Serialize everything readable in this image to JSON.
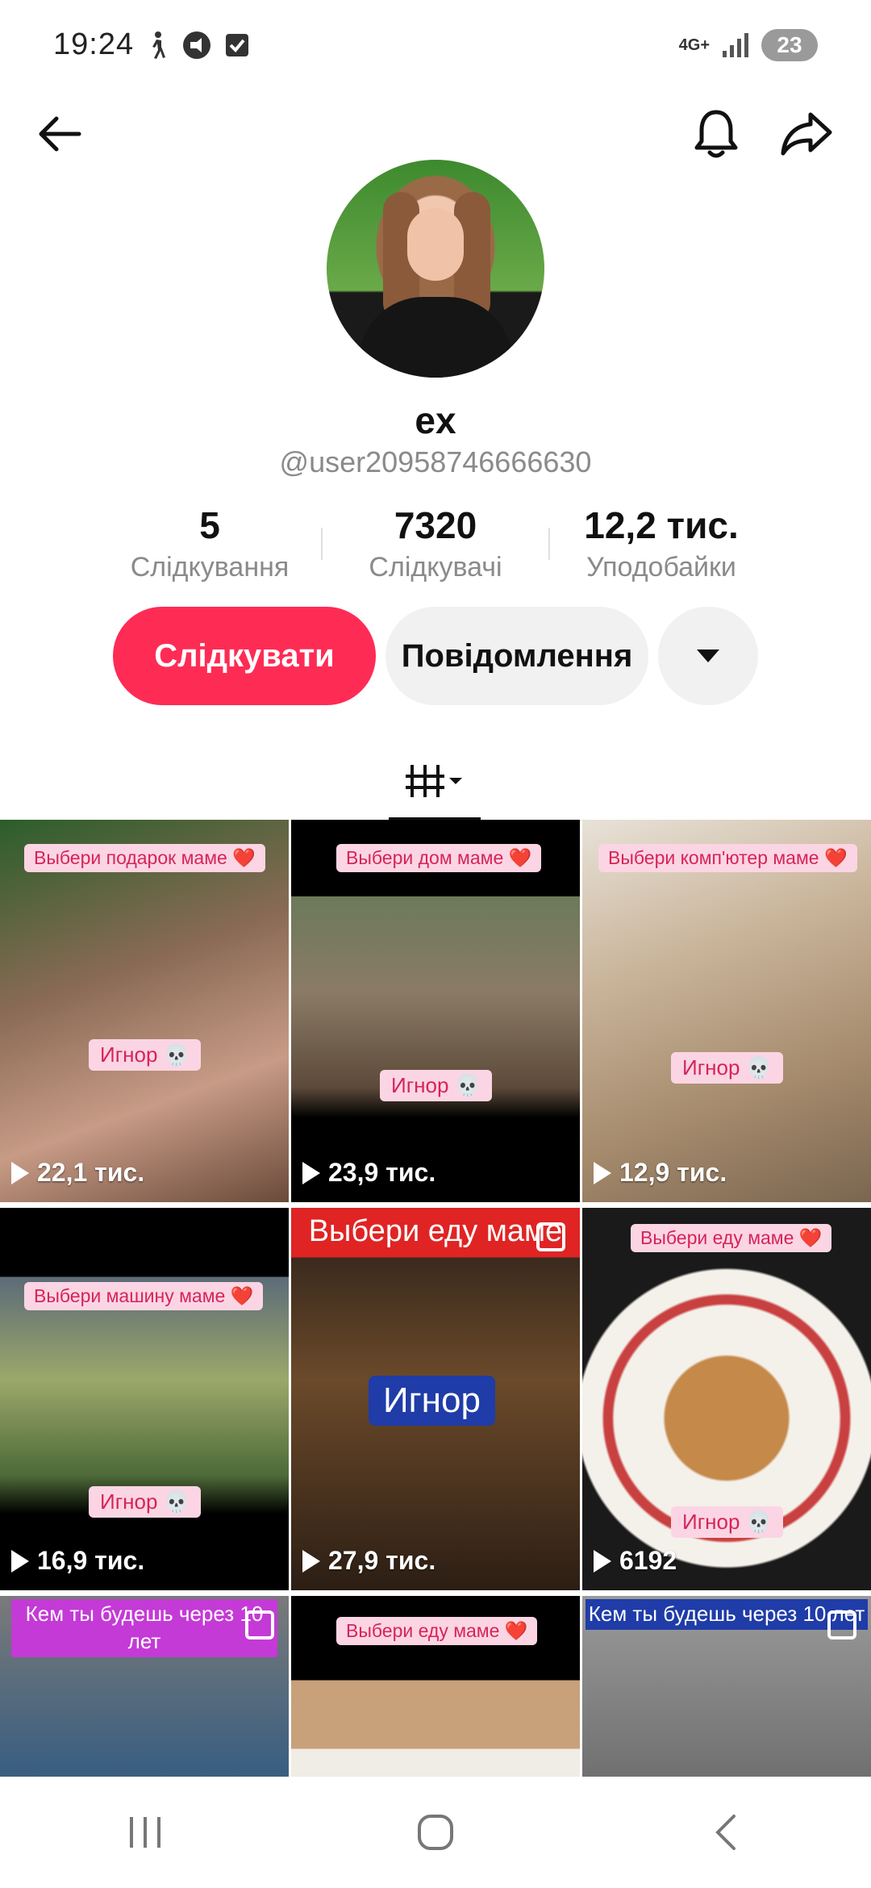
{
  "status_bar": {
    "time": "19:24",
    "network": "4G+",
    "battery": "23"
  },
  "profile": {
    "display_name": "ex",
    "handle": "@user20958746666630",
    "stats": [
      {
        "value": "5",
        "label": "Слідкування"
      },
      {
        "value": "7320",
        "label": "Слідкувачі"
      },
      {
        "value": "12,2 тис.",
        "label": "Уподобайки"
      }
    ],
    "follow_label": "Слідкувати",
    "message_label": "Повідомлення"
  },
  "videos": [
    {
      "caption": "Выбери подарок маме ❤️",
      "overlay": "Игнор 💀",
      "views": "22,1 тис."
    },
    {
      "caption": "Выбери дом маме ❤️",
      "overlay": "Игнор 💀",
      "views": "23,9 тис."
    },
    {
      "caption": "Выбери комп'ютер маме ❤️",
      "overlay": "Игнор 💀",
      "views": "12,9 тис."
    },
    {
      "caption": "Выбери машину  маме ❤️",
      "overlay": "Игнор 💀",
      "views": "16,9 тис."
    },
    {
      "caption": "Выбери еду маме",
      "overlay": "Игнор",
      "views": "27,9 тис."
    },
    {
      "caption": "Выбери еду маме ❤️",
      "overlay": "Игнор 💀",
      "views": "6192"
    },
    {
      "caption": "Кем ты будешь через 10 лет",
      "overlay": "",
      "views": ""
    },
    {
      "caption": "Выбери еду маме ❤️",
      "overlay": "",
      "views": ""
    },
    {
      "caption": "Кем ты будешь через 10 лет",
      "overlay": "",
      "views": ""
    }
  ],
  "colors": {
    "accent": "#fe2c55",
    "secondary_button": "#f1f1f2",
    "caption_pill": "#fbd5e3"
  }
}
